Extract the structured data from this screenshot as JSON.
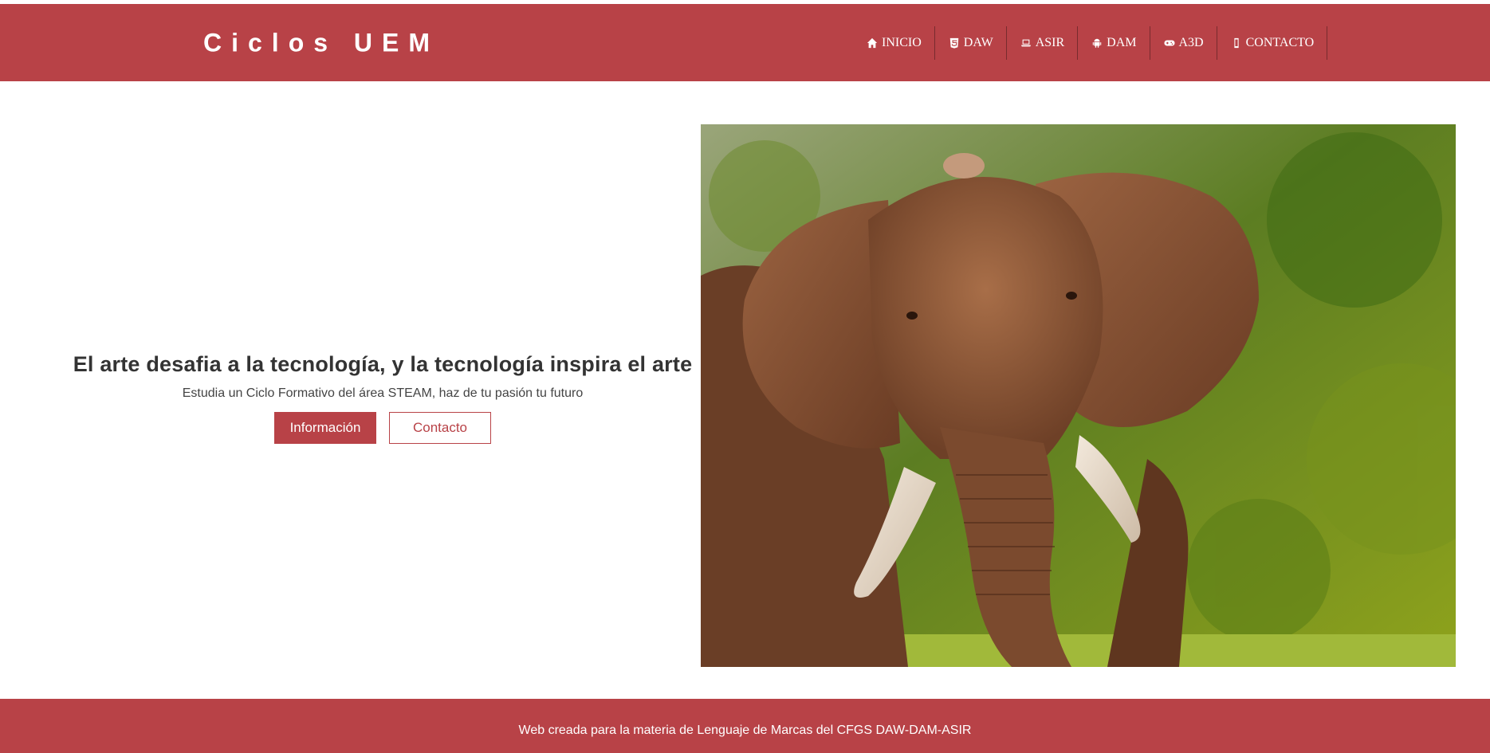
{
  "header": {
    "brand": "Ciclos UEM",
    "nav": [
      {
        "label": "INICIO",
        "icon": "home-icon"
      },
      {
        "label": "DAW",
        "icon": "html5-icon"
      },
      {
        "label": "ASIR",
        "icon": "laptop-icon"
      },
      {
        "label": "DAM",
        "icon": "android-icon"
      },
      {
        "label": "A3D",
        "icon": "gamepad-icon"
      },
      {
        "label": "CONTACTO",
        "icon": "mobile-icon"
      }
    ]
  },
  "hero": {
    "title": "El arte desafia a la tecnología, y la tecnología inspira el arte",
    "subtitle": "Estudia un Ciclo Formativo del área STEAM, haz de tu pasión tu futuro",
    "primary_button": "Información",
    "secondary_button": "Contacto",
    "image": "elephant-photo"
  },
  "footer": {
    "text": "Web creada para la materia de Lenguaje de Marcas del CFGS DAW-DAM-ASIR"
  },
  "colors": {
    "brand": "#b84247",
    "text": "#333333",
    "background": "#ffffff"
  }
}
